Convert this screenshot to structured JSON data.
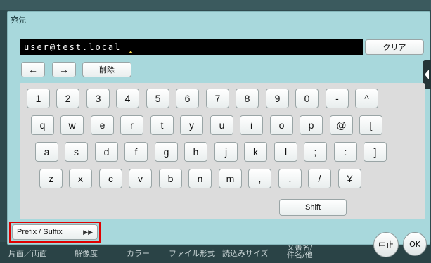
{
  "title": "宛先",
  "input": {
    "value": "user@test.local"
  },
  "buttons": {
    "clear": "クリア",
    "back_arrow": "←",
    "forward_arrow": "→",
    "delete": "削除",
    "shift": "Shift",
    "prefix_suffix": "Prefix / Suffix",
    "prefix_suffix_icon": "▶▶",
    "stop": "中止",
    "ok": "OK"
  },
  "keys": {
    "row1": [
      "1",
      "2",
      "3",
      "4",
      "5",
      "6",
      "7",
      "8",
      "9",
      "0",
      "-",
      "^"
    ],
    "row2": [
      "q",
      "w",
      "e",
      "r",
      "t",
      "y",
      "u",
      "i",
      "o",
      "p",
      "@",
      "["
    ],
    "row3": [
      "a",
      "s",
      "d",
      "f",
      "g",
      "h",
      "j",
      "k",
      "l",
      ";",
      ":",
      "]"
    ],
    "row4": [
      "z",
      "x",
      "c",
      "v",
      "b",
      "n",
      "m",
      ",",
      ".",
      "/",
      "¥"
    ]
  },
  "bottom_bar": {
    "items": [
      "片面／両面",
      "解像度",
      "カラー",
      "ファイル形式",
      "読込みサイズ",
      "文書名/\n件名/他"
    ]
  },
  "icons": {
    "side_tab": "chevron-left-icon",
    "prefix_suffix": "fast-forward-icon"
  }
}
